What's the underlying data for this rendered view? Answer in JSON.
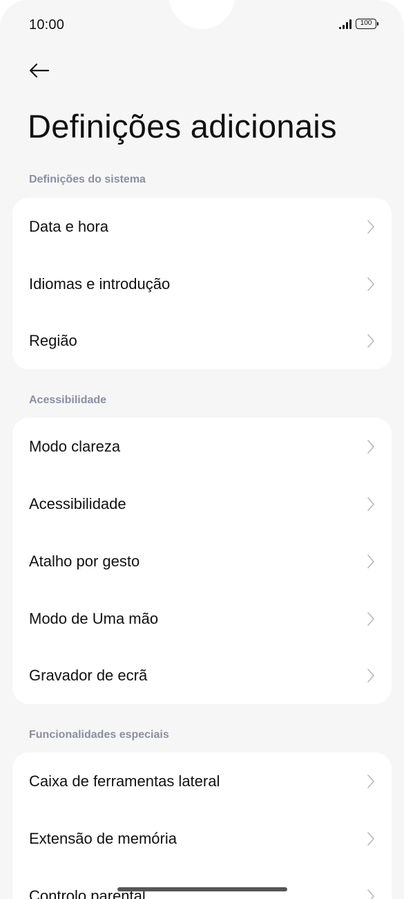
{
  "status_bar": {
    "time": "10:00",
    "battery": "100"
  },
  "header": {
    "title": "Definições adicionais"
  },
  "sections": [
    {
      "header": "Definições do sistema",
      "items": [
        {
          "label": "Data e hora"
        },
        {
          "label": "Idiomas e introdução"
        },
        {
          "label": "Região"
        }
      ]
    },
    {
      "header": "Acessibilidade",
      "items": [
        {
          "label": "Modo clareza"
        },
        {
          "label": "Acessibilidade"
        },
        {
          "label": "Atalho por gesto"
        },
        {
          "label": "Modo de Uma mão"
        },
        {
          "label": "Gravador de ecrã"
        }
      ]
    },
    {
      "header": "Funcionalidades especiais",
      "items": [
        {
          "label": "Caixa de ferramentas lateral"
        },
        {
          "label": "Extensão de memória"
        },
        {
          "label": "Controlo parental"
        }
      ]
    }
  ]
}
